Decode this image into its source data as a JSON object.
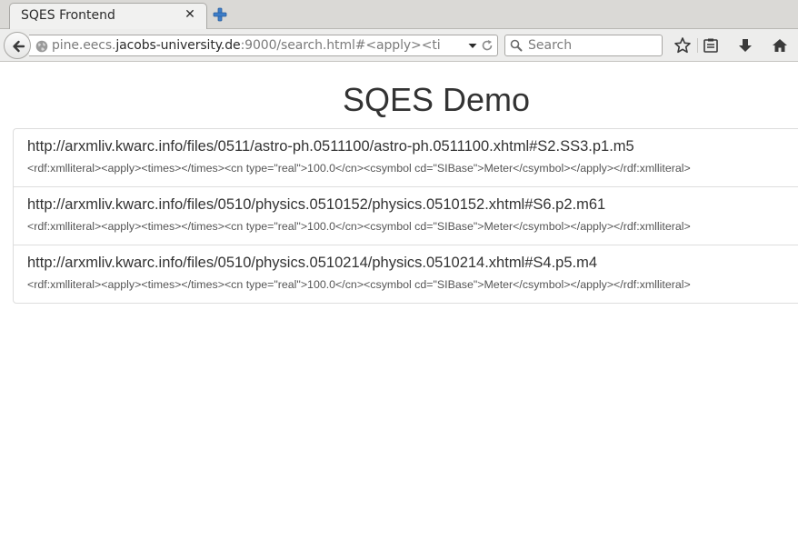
{
  "browser": {
    "tab": {
      "title": "SQES Frontend",
      "close_glyph": "✕"
    },
    "new_tab_icon": "plus-icon",
    "url": {
      "scheme_part": "pine.eecs.",
      "host_part": "jacobs-university.de",
      "rest_part": ":9000/search.html#<apply><ti"
    },
    "search": {
      "placeholder": "Search"
    },
    "toolbar_icons": [
      "star-icon",
      "reading-list-icon",
      "download-icon",
      "home-icon"
    ]
  },
  "page": {
    "title": "SQES Demo",
    "results": [
      {
        "heading": "http://arxmliv.kwarc.info/files/0511/astro-ph.0511100/astro-ph.0511100.xhtml#S2.SS3.p1.m5",
        "text": "<rdf:xmlliteral><apply><times></times><cn type=\"real\">100.0</cn><csymbol cd=\"SIBase\">Meter</csymbol></apply></rdf:xmlliteral>"
      },
      {
        "heading": "http://arxmliv.kwarc.info/files/0510/physics.0510152/physics.0510152.xhtml#S6.p2.m61",
        "text": "<rdf:xmlliteral><apply><times></times><cn type=\"real\">100.0</cn><csymbol cd=\"SIBase\">Meter</csymbol></apply></rdf:xmlliteral>"
      },
      {
        "heading": "http://arxmliv.kwarc.info/files/0510/physics.0510214/physics.0510214.xhtml#S4.p5.m4",
        "text": "<rdf:xmlliteral><apply><times></times><cn type=\"real\">100.0</cn><csymbol cd=\"SIBase\">Meter</csymbol></apply></rdf:xmlliteral>"
      }
    ]
  }
}
